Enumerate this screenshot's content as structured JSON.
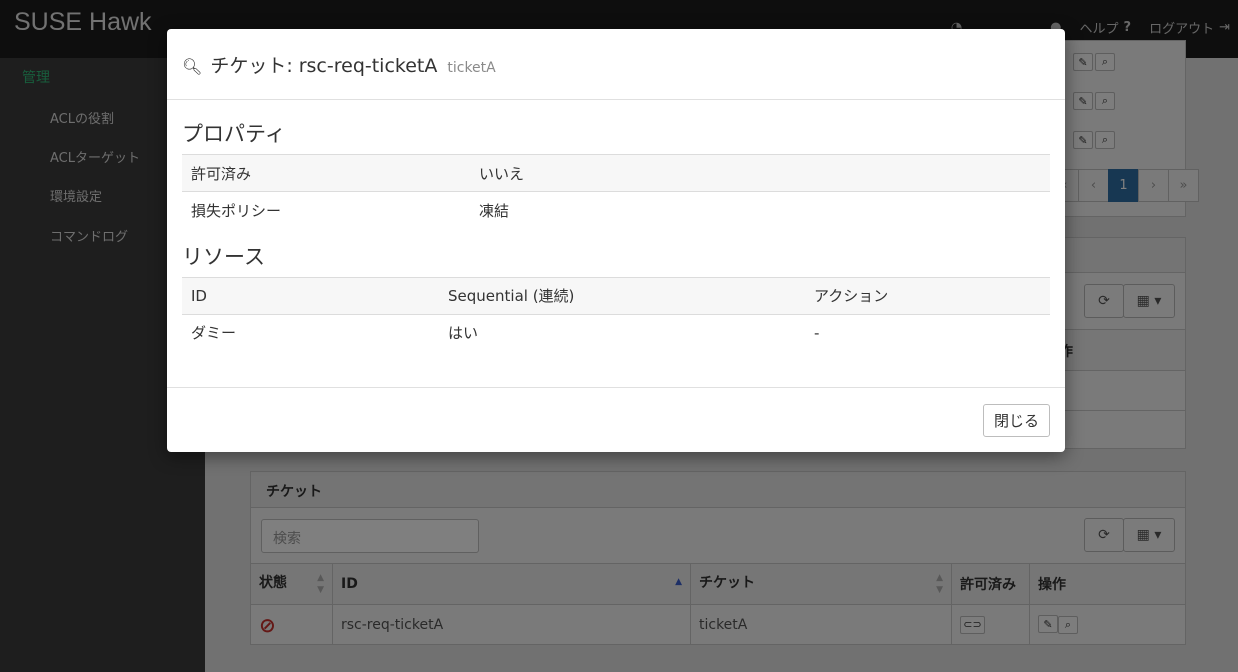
{
  "app": {
    "brand": "SUSE Hawk"
  },
  "topnav": {
    "help": "ヘルプ",
    "logout": "ログアウト"
  },
  "sidebar": {
    "section": "管理",
    "items": [
      {
        "label": "ACLの役割"
      },
      {
        "label": "ACLターゲット"
      },
      {
        "label": "環境設定"
      },
      {
        "label": "コマンドログ"
      }
    ]
  },
  "upper_panel": {
    "pager": [
      "«",
      "‹",
      "1",
      "›",
      "»"
    ],
    "ops_header": "作"
  },
  "tickets_panel": {
    "title": "チケット",
    "search_placeholder": "検索",
    "columns": [
      "状態",
      "ID",
      "チケット",
      "許可済み",
      "操作"
    ],
    "rows": [
      {
        "id": "rsc-req-ticketA",
        "ticket": "ticketA"
      }
    ]
  },
  "modal": {
    "title_prefix": "チケット:",
    "title_id": "rsc-req-ticketA",
    "title_sub": "ticketA",
    "properties_heading": "プロパティ",
    "properties": [
      {
        "key": "許可済み",
        "value": "いいえ"
      },
      {
        "key": "損失ポリシー",
        "value": "凍結"
      }
    ],
    "resources_heading": "リソース",
    "resources_columns": [
      "ID",
      "Sequential (連続)",
      "アクション"
    ],
    "resources_rows": [
      {
        "id": "ダミー",
        "sequential": "はい",
        "action": "-"
      }
    ],
    "close_label": "閉じる"
  },
  "colors": {
    "accent": "#30ba78",
    "primary": "#2f6ea4",
    "danger": "#c9302c"
  }
}
